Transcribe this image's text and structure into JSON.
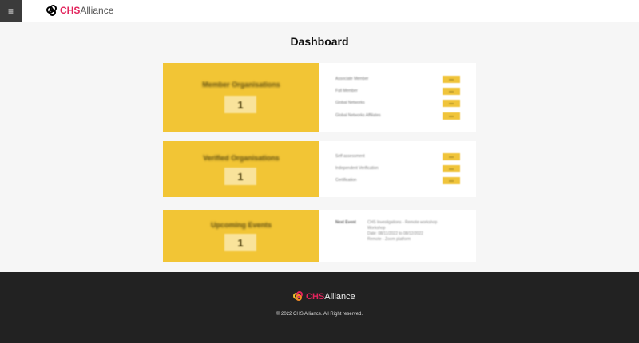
{
  "header": {
    "logo_part1": "CHS",
    "logo_part2": "Alliance",
    "menu_icon": "≡"
  },
  "page": {
    "title": "Dashboard"
  },
  "cards": [
    {
      "title": "Member Organisations",
      "count": "1",
      "rows": [
        {
          "label": "Associate Member",
          "button": "xxx"
        },
        {
          "label": "Full Member",
          "button": "xxx"
        },
        {
          "label": "Global Networks",
          "button": "xxx"
        },
        {
          "label": "Global Networks Affiliates",
          "button": "xxx"
        }
      ]
    },
    {
      "title": "Verified Organisations",
      "count": "1",
      "rows": [
        {
          "label": "Self assessment",
          "button": "xxx"
        },
        {
          "label": "Independent Verification",
          "button": "xxx"
        },
        {
          "label": "Certification",
          "button": "xxx"
        }
      ]
    },
    {
      "title": "Upcoming Events",
      "count": "1",
      "event": {
        "label": "Next Event",
        "lines": [
          "CHS Investigations - Remote workshop",
          "Workshop",
          "Date: 08/11/2022 to 08/12/2022",
          "Remote - Zoom platform"
        ]
      }
    }
  ],
  "footer": {
    "logo_part1": "CHS",
    "logo_part2": "Alliance",
    "copyright": "© 2022 CHS Alliance. All Right reserved."
  },
  "colors": {
    "accent": "#f2c535",
    "brand": "#e2245c",
    "footer_bg": "#222222"
  }
}
